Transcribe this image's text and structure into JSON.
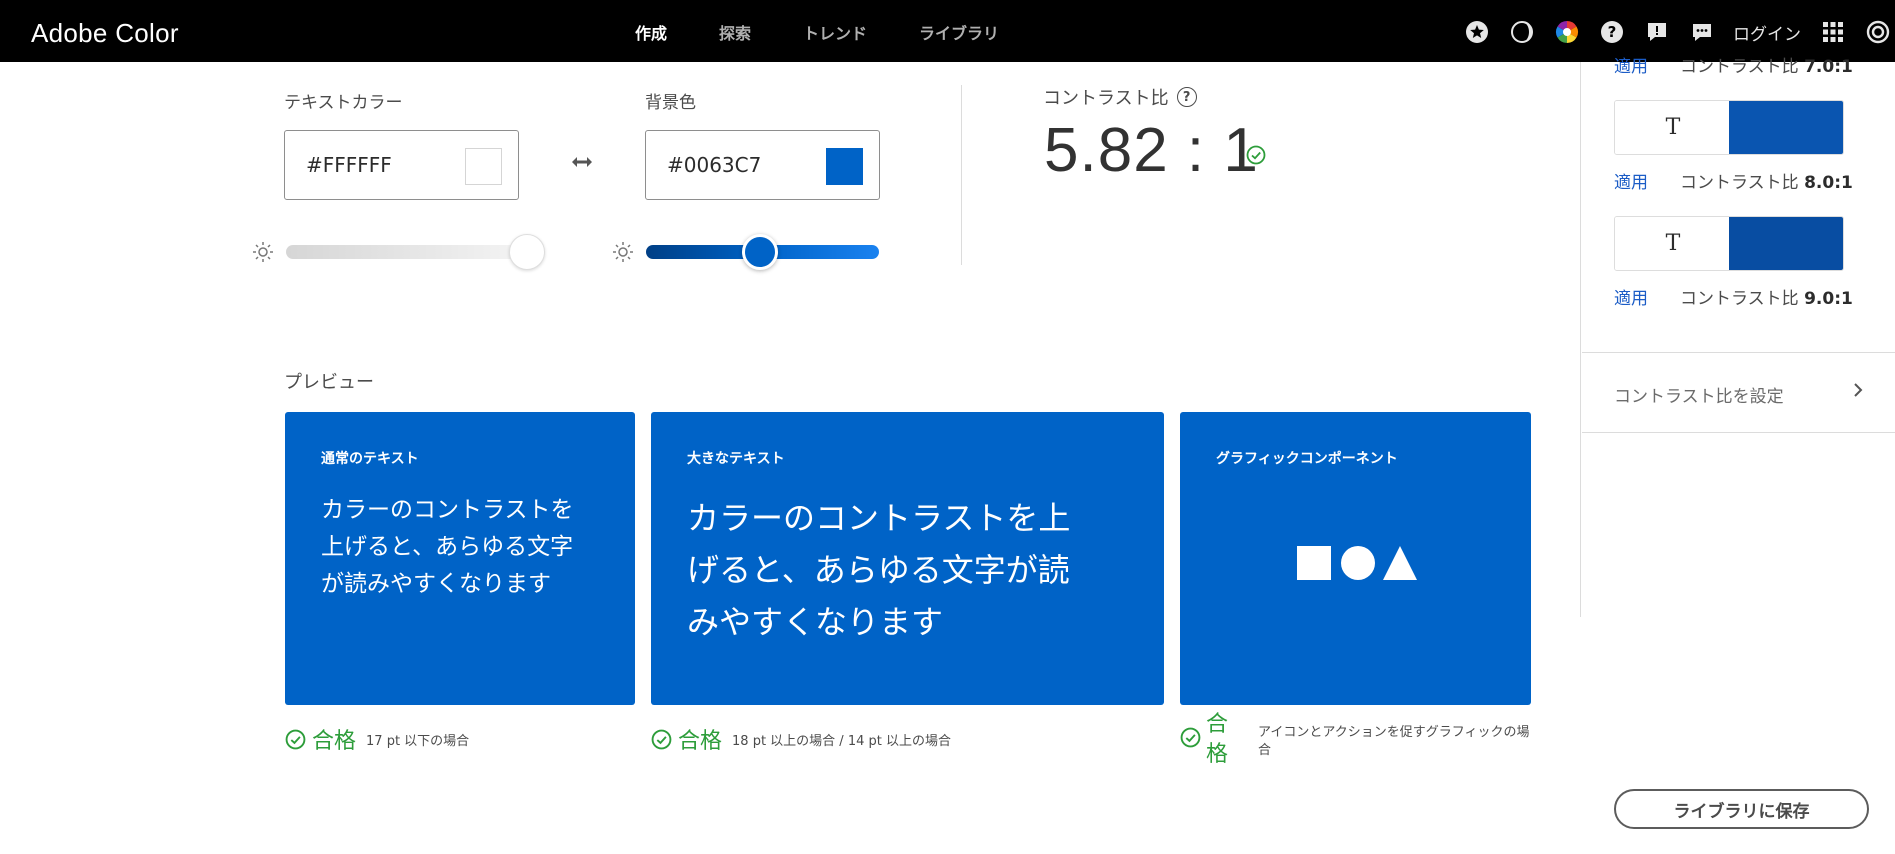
{
  "app": {
    "title": "Adobe Color"
  },
  "nav": {
    "items": [
      {
        "label": "作成",
        "active": true
      },
      {
        "label": "探索",
        "active": false
      },
      {
        "label": "トレンド",
        "active": false
      },
      {
        "label": "ライブラリ",
        "active": false
      }
    ]
  },
  "header": {
    "login_label": "ログイン",
    "icons": [
      "star-icon",
      "moon-icon",
      "color-wheel-icon",
      "help-icon",
      "feedback-icon",
      "chat-icon",
      "apps-grid-icon",
      "creative-cloud-icon"
    ]
  },
  "text_color": {
    "label": "テキストカラー",
    "value": "#FFFFFF",
    "brightness": 1.0
  },
  "background_color": {
    "label": "背景色",
    "value": "#0063C7",
    "brightness": 0.49
  },
  "contrast": {
    "label": "コントラスト比",
    "value": "5.82 : 1"
  },
  "preview": {
    "label": "プレビュー",
    "cards": [
      {
        "title": "通常のテキスト",
        "text": "カラーのコントラストを上げると、あらゆる文字が読みやすくなります",
        "pass_label": "合格",
        "note": "17 pt 以下の場合"
      },
      {
        "title": "大きなテキスト",
        "text": "カラーのコントラストを上げると、あらゆる文字が読みやすくなります",
        "pass_label": "合格",
        "note": "18 pt 以上の場合 / 14 pt 以上の場合"
      },
      {
        "title": "グラフィックコンポーネント",
        "pass_label": "合格",
        "note": "アイコンとアクションを促すグラフィックの場合"
      }
    ]
  },
  "suggestions": {
    "top_partial": {
      "apply_label": "適用",
      "ratio_label": "コントラスト比",
      "ratio_value": "7.0:1"
    },
    "items": [
      {
        "sample_text": "T",
        "color": "#0a55b0",
        "apply_label": "適用",
        "ratio_label": "コントラスト比",
        "ratio_value": "8.0:1"
      },
      {
        "sample_text": "T",
        "color": "#084da2",
        "apply_label": "適用",
        "ratio_label": "コントラスト比",
        "ratio_value": "9.0:1"
      }
    ],
    "set_ratio_label": "コントラスト比を設定"
  },
  "save_button_label": "ライブラリに保存",
  "colors": {
    "blue": "#0063C7",
    "pass_green": "#2d9d3a",
    "link": "#1b5cc6"
  }
}
